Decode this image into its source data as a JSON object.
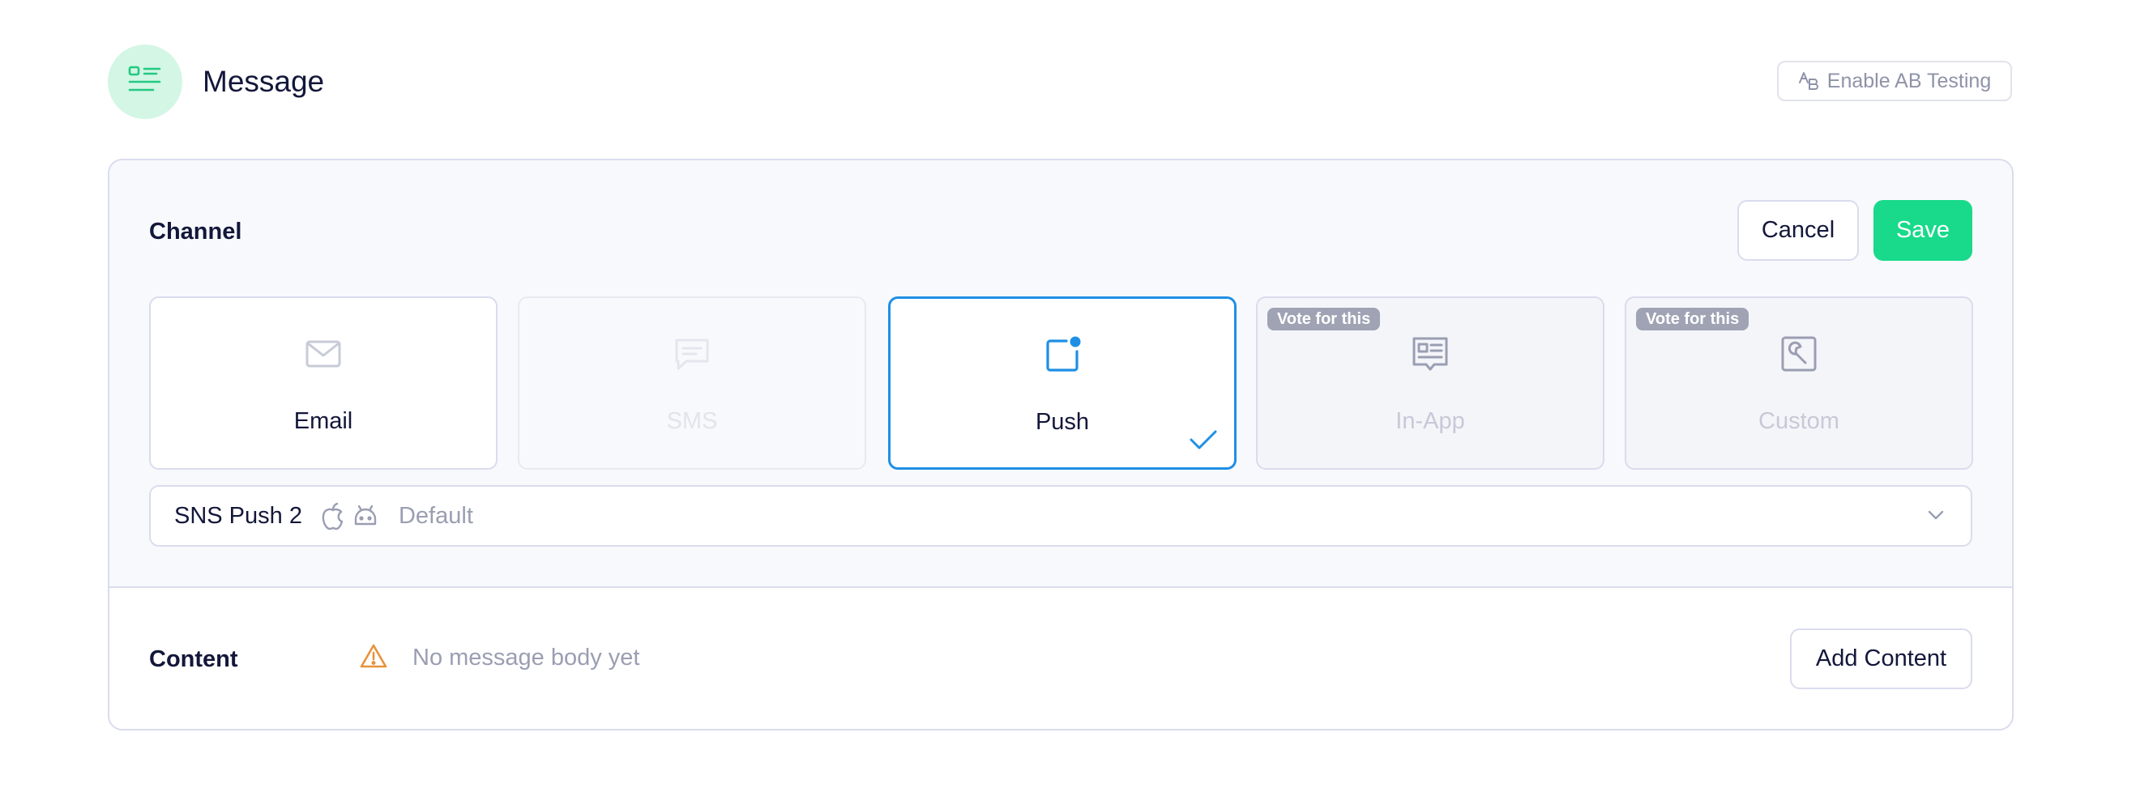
{
  "header": {
    "title": "Message",
    "icon": "list-icon",
    "ab_testing_label": "Enable AB Testing"
  },
  "channel": {
    "label": "Channel",
    "cancel_label": "Cancel",
    "save_label": "Save",
    "options": [
      {
        "label": "Email",
        "icon": "mail-icon",
        "state": "enabled"
      },
      {
        "label": "SMS",
        "icon": "chat-icon",
        "state": "disabled"
      },
      {
        "label": "Push",
        "icon": "push-icon",
        "state": "selected"
      },
      {
        "label": "In-App",
        "icon": "in-app-icon",
        "state": "vote",
        "badge": "Vote for this"
      },
      {
        "label": "Custom",
        "icon": "wrench-icon",
        "state": "vote",
        "badge": "Vote for this"
      }
    ],
    "provider": {
      "name": "SNS Push 2",
      "platforms": [
        "apple-icon",
        "android-icon"
      ],
      "value": "Default"
    }
  },
  "content": {
    "label": "Content",
    "empty_message": "No message body yet",
    "add_label": "Add Content"
  },
  "colors": {
    "accent_green": "#18da8a",
    "selected_blue": "#1f8fe5",
    "warning": "#e8923a"
  }
}
